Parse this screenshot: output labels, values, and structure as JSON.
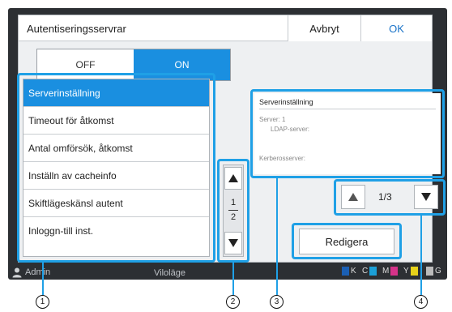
{
  "dialog": {
    "title": "Autentiseringsservrar",
    "cancel_label": "Avbryt",
    "ok_label": "OK"
  },
  "toggle": {
    "off_label": "OFF",
    "on_label": "ON",
    "selected": "ON"
  },
  "menu": {
    "items": [
      "Serverinställning",
      "Timeout för åtkomst",
      "Antal omförsök, åtkomst",
      "Inställn av cacheinfo",
      "Skiftlägeskänsl autent",
      "Inloggn-till inst."
    ],
    "selected_index": 0,
    "page_current": "1",
    "page_total": "2"
  },
  "info_panel": {
    "title": "Serverinställning",
    "server_line": "Server: 1",
    "ldap_line": "LDAP-server:",
    "kerberos_line": "Kerberosserver:"
  },
  "pager": {
    "text": "1/3"
  },
  "edit_label": "Redigera",
  "statusbar": {
    "user": "Admin",
    "mode": "Viloläge",
    "ink": [
      "K",
      "C",
      "M",
      "Y",
      "G"
    ]
  },
  "callouts": [
    "1",
    "2",
    "3",
    "4"
  ],
  "colors": {
    "accent": "#1a8fe0",
    "highlight": "#1fa0e6",
    "ok_text": "#1a73c8",
    "ink_k": "#1a5fb4",
    "ink_c": "#1ba0d8",
    "ink_m": "#d6338a",
    "ink_y": "#e8d21a"
  },
  "icons": [
    "user-icon",
    "arrow-up-icon",
    "arrow-down-icon",
    "notch-indicator"
  ]
}
